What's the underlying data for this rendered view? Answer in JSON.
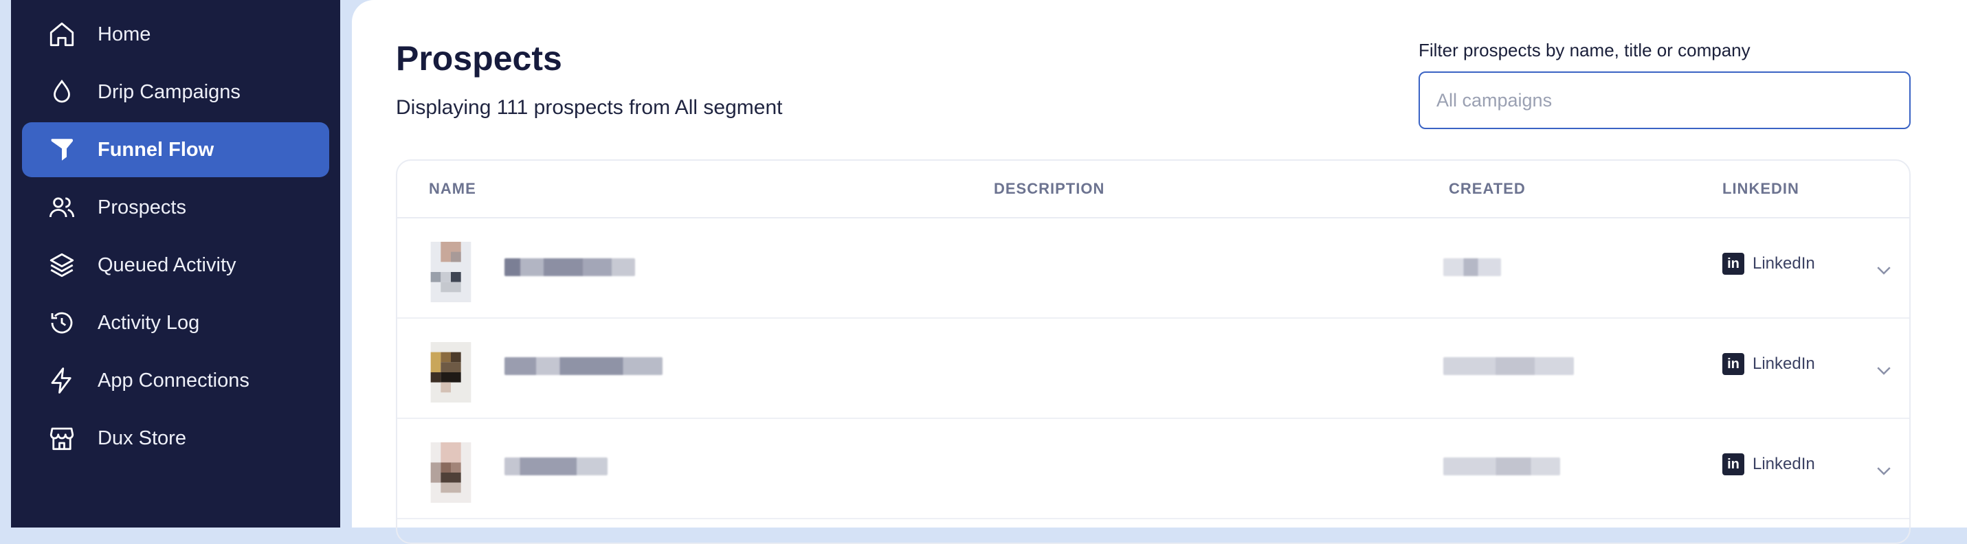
{
  "sidebar": {
    "items": [
      {
        "label": "Home",
        "icon": "home-icon",
        "active": false
      },
      {
        "label": "Drip Campaigns",
        "icon": "droplet-icon",
        "active": false
      },
      {
        "label": "Funnel Flow",
        "icon": "funnel-icon",
        "active": true
      },
      {
        "label": "Prospects",
        "icon": "users-icon",
        "active": false
      },
      {
        "label": "Queued Activity",
        "icon": "layers-icon",
        "active": false
      },
      {
        "label": "Activity Log",
        "icon": "history-icon",
        "active": false
      },
      {
        "label": "App Connections",
        "icon": "bolt-icon",
        "active": false
      },
      {
        "label": "Dux Store",
        "icon": "store-icon",
        "active": false
      }
    ]
  },
  "header": {
    "title": "Prospects",
    "subtitle": "Displaying 111 prospects from All segment"
  },
  "filter": {
    "label": "Filter prospects by name, title or company",
    "placeholder": "All campaigns",
    "value": ""
  },
  "table": {
    "columns": [
      "NAME",
      "DESCRIPTION",
      "CREATED",
      "LINKEDIN"
    ],
    "rows": [
      {
        "name": "",
        "created": "",
        "linkedin": "LinkedIn"
      },
      {
        "name": "",
        "created": "",
        "linkedin": "LinkedIn"
      },
      {
        "name": "",
        "created": "",
        "linkedin": "LinkedIn"
      }
    ]
  },
  "colors": {
    "sidebar_bg": "#181d3f",
    "active_item": "#3a63c4",
    "page_bg": "#d5e2f6"
  }
}
